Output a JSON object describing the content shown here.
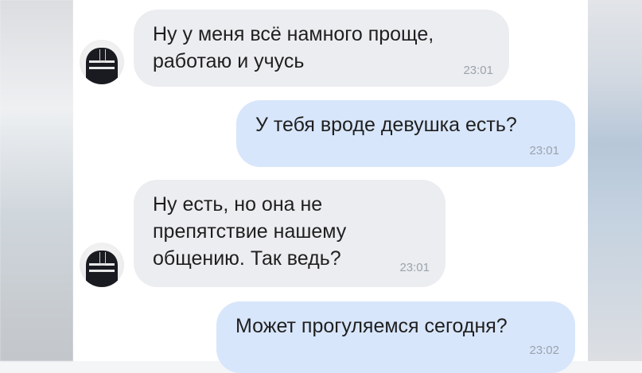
{
  "messages": [
    {
      "direction": "incoming",
      "text": "Ну у меня всё намного проще,\nработаю и учусь",
      "time": "23:01"
    },
    {
      "direction": "outgoing",
      "text": "У тебя вроде девушка есть?",
      "time": "23:01"
    },
    {
      "direction": "incoming",
      "text": "Ну есть, но она не\nпрепятствие нашему\nобщению. Так ведь?",
      "time": "23:01"
    },
    {
      "direction": "outgoing",
      "text": "Может прогуляемся сегодня?",
      "time": "23:02"
    }
  ],
  "avatar_icon": "user-avatar-icon"
}
